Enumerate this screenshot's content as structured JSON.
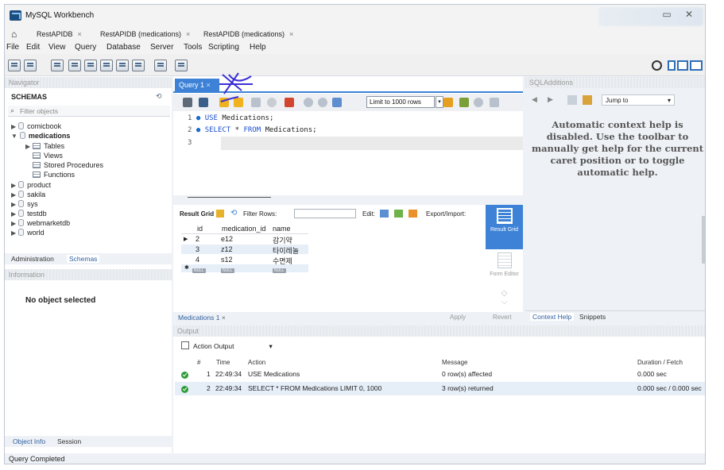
{
  "window": {
    "title": "MySQL Workbench"
  },
  "conn_tabs": [
    {
      "label": "RestAPIDB",
      "close": "×"
    },
    {
      "label": "RestAPIDB (medications)",
      "close": "×"
    },
    {
      "label": "RestAPIDB (medications)",
      "close": "×"
    }
  ],
  "menu": [
    "File",
    "Edit",
    "View",
    "Query",
    "Database",
    "Server",
    "Tools",
    "Scripting",
    "Help"
  ],
  "navigator": {
    "header": "Navigator",
    "schemas_label": "SCHEMAS",
    "filter_placeholder": "Filter objects",
    "tree": [
      {
        "label": "comicbook"
      },
      {
        "label": "medications"
      },
      {
        "label": "Tables"
      },
      {
        "label": "Views"
      },
      {
        "label": "Stored Procedures"
      },
      {
        "label": "Functions"
      },
      {
        "label": "product"
      },
      {
        "label": "sakila"
      },
      {
        "label": "sys"
      },
      {
        "label": "testdb"
      },
      {
        "label": "webmarketdb"
      },
      {
        "label": "world"
      }
    ],
    "tabs": [
      "Administration",
      "Schemas"
    ],
    "info_header": "Information",
    "no_object": "No object selected",
    "bottom_tabs": [
      "Object Info",
      "Session"
    ]
  },
  "editor": {
    "tab_label": "Query 1",
    "tab_close": "×",
    "limit": "Limit to 1000 rows",
    "lines": [
      {
        "num": "1",
        "kw": "USE",
        "rest": " Medications;"
      },
      {
        "num": "2",
        "kw": "SELECT",
        "rest": " * ",
        "kw2": "FROM",
        "rest2": " Medications;"
      },
      {
        "num": "3",
        "kw": "",
        "rest": ""
      }
    ]
  },
  "result": {
    "toolbar": {
      "result_grid": "Result Grid",
      "filter_rows": "Filter Rows:",
      "edit": "Edit:",
      "export": "Export/Import:"
    },
    "columns": [
      "id",
      "medication_id",
      "name"
    ],
    "rows": [
      [
        "2",
        "e12",
        "감기약"
      ],
      [
        "3",
        "z12",
        "타이레놀"
      ],
      [
        "4",
        "s12",
        "수면제"
      ]
    ],
    "null_label": "NULL",
    "side": {
      "result_grid": "Result Grid",
      "form_editor": "Form Editor"
    },
    "bottom_tab": "Medications 1",
    "bottom_close": "×",
    "apply": "Apply",
    "revert": "Revert"
  },
  "sql_additions": {
    "header": "SQLAdditions",
    "jump_to": "Jump to",
    "help_text": "Automatic context help is disabled. Use the toolbar to manually get help for the current caret position or to toggle automatic help.",
    "tabs": [
      "Context Help",
      "Snippets"
    ]
  },
  "output": {
    "header": "Output",
    "selector": "Action Output",
    "columns": [
      "#",
      "Time",
      "Action",
      "Message",
      "Duration / Fetch"
    ],
    "rows": [
      [
        "1",
        "22:49:34",
        "USE Medications",
        "0 row(s) affected",
        "0.000 sec"
      ],
      [
        "2",
        "22:49:34",
        "SELECT * FROM Medications LIMIT 0, 1000",
        "3 row(s) returned",
        "0.000 sec / 0.000 sec"
      ]
    ]
  },
  "status": "Query Completed",
  "colors": {
    "accent": "#3d82d6",
    "ok": "#2e9b38",
    "annotation": "#3b2fd6"
  }
}
